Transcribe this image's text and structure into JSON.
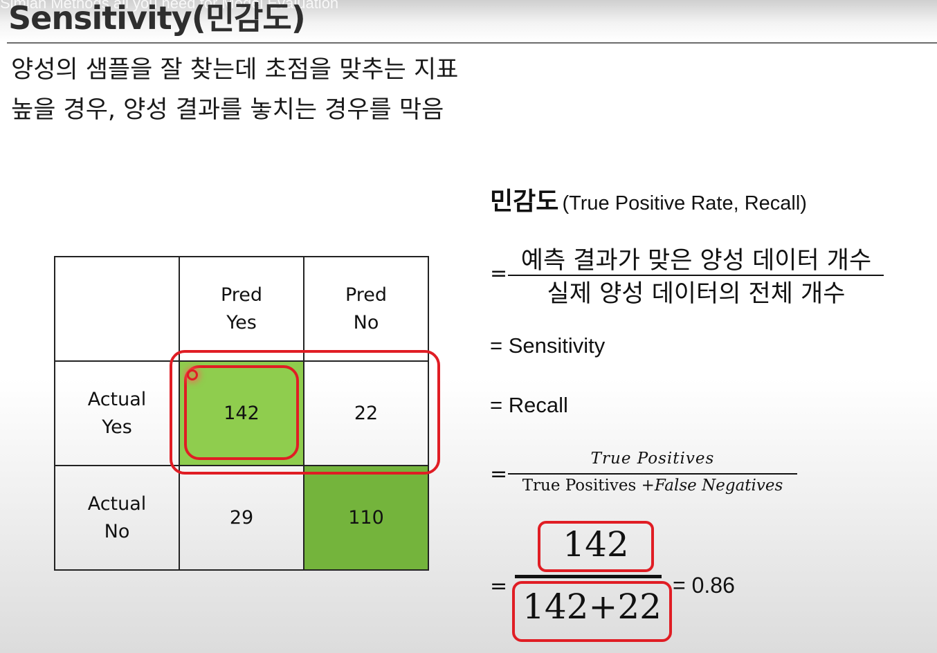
{
  "video_title": "Simian Methods all you need for Model Evaluation",
  "heading": "Sensitivity(민감도)",
  "bullets": [
    "양성의 샘플을 잘 찾는데 초점을 맞추는 지표",
    "높을 경우, 양성 결과를 놓치는 경우를  막음"
  ],
  "matrix": {
    "col_headers": [
      [
        "Pred",
        "Yes"
      ],
      [
        "Pred",
        "No"
      ]
    ],
    "row_headers": [
      [
        "Actual",
        "Yes"
      ],
      [
        "Actual",
        "No"
      ]
    ],
    "cells": [
      [
        "142",
        "22"
      ],
      [
        "29",
        "110"
      ]
    ]
  },
  "formula": {
    "title_ko": "민감도",
    "title_en": "(True Positive Rate, Recall)",
    "eq": "=",
    "numerator_ko": "예측 결과가 맞은 양성 데이터 개수",
    "denominator_ko": "실제 양성 데이터의 전체 개수",
    "sensitivity": "= Sensitivity",
    "recall": "= Recall",
    "numerator_en": "True Positives",
    "denominator_en_a": "True Positives",
    "denominator_en_b": "+False Negatives",
    "num_value": "142",
    "den_value": "142+22",
    "result": "= 0.86"
  },
  "colors": {
    "tp_cell": "#8fcd4e",
    "tn_cell": "#74b43c",
    "highlight": "#e01d24"
  }
}
